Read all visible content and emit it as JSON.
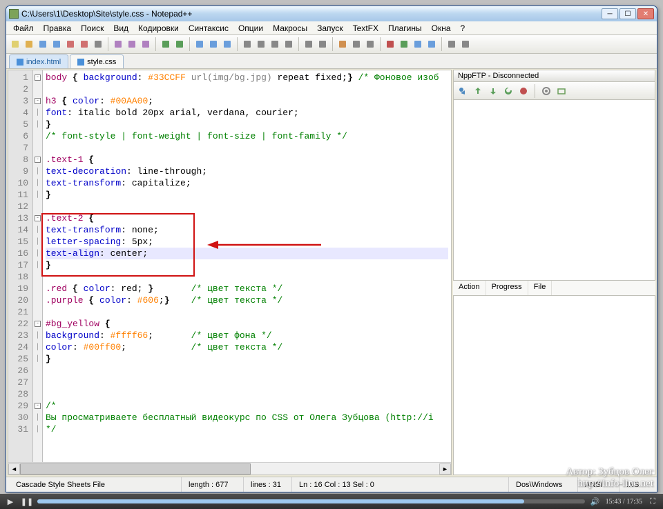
{
  "window": {
    "title": "C:\\Users\\1\\Desktop\\Site\\style.css - Notepad++"
  },
  "menu": {
    "items": [
      "Файл",
      "Правка",
      "Поиск",
      "Вид",
      "Кодировки",
      "Синтаксис",
      "Опции",
      "Макросы",
      "Запуск",
      "TextFX",
      "Плагины",
      "Окна",
      "?"
    ]
  },
  "tabs": [
    {
      "label": "index.html",
      "active": false
    },
    {
      "label": "style.css",
      "active": true
    }
  ],
  "code": {
    "lines_total": 31,
    "highlight_line": 16,
    "lines": [
      {
        "n": 1,
        "fold": "-",
        "html": "<span class='sel'>body</span> <span class='brace'>{</span> <span class='kw'>background</span>: <span class='num'>#33CCFF</span> <span class='str'>url(img/bg.jpg)</span> repeat fixed;<span class='brace'>}</span> <span class='comment'>/* Фоновое изоб</span>"
      },
      {
        "n": 2,
        "fold": "",
        "html": ""
      },
      {
        "n": 3,
        "fold": "-",
        "html": "<span class='sel'>h3</span> <span class='brace'>{</span> <span class='kw'>color</span>: <span class='num'>#00AA00</span>;"
      },
      {
        "n": 4,
        "fold": "|",
        "html": "<span class='kw'>font</span>: italic bold 20px arial, verdana, courier;"
      },
      {
        "n": 5,
        "fold": "|",
        "html": "<span class='brace'>}</span>"
      },
      {
        "n": 6,
        "fold": "",
        "html": "<span class='comment'>/* font-style | font-weight | font-size | font-family */</span>"
      },
      {
        "n": 7,
        "fold": "",
        "html": ""
      },
      {
        "n": 8,
        "fold": "-",
        "html": "<span class='sel'>.text-1</span> <span class='brace'>{</span>"
      },
      {
        "n": 9,
        "fold": "|",
        "html": "<span class='kw'>text-decoration</span>: line-through;"
      },
      {
        "n": 10,
        "fold": "|",
        "html": "<span class='kw'>text-transform</span>: capitalize;"
      },
      {
        "n": 11,
        "fold": "|",
        "html": "<span class='brace'>}</span>"
      },
      {
        "n": 12,
        "fold": "",
        "html": ""
      },
      {
        "n": 13,
        "fold": "-",
        "html": "<span class='sel'>.text-2</span> <span class='brace'>{</span>"
      },
      {
        "n": 14,
        "fold": "|",
        "html": "<span class='kw'>text-transform</span>: none;"
      },
      {
        "n": 15,
        "fold": "|",
        "html": "<span class='kw'>letter-spacing</span>: 5px;"
      },
      {
        "n": 16,
        "fold": "|",
        "html": "<span class='kw'>text-align</span>: center;"
      },
      {
        "n": 17,
        "fold": "|",
        "html": "<span class='brace'>}</span>"
      },
      {
        "n": 18,
        "fold": "",
        "html": ""
      },
      {
        "n": 19,
        "fold": "",
        "html": "<span class='sel'>.red</span> <span class='brace'>{</span> <span class='kw'>color</span>: red; <span class='brace'>}</span>       <span class='comment'>/* цвет текста */</span>"
      },
      {
        "n": 20,
        "fold": "",
        "html": "<span class='sel'>.purple</span> <span class='brace'>{</span> <span class='kw'>color</span>: <span class='num'>#606</span>;<span class='brace'>}</span>    <span class='comment'>/* цвет текста */</span>"
      },
      {
        "n": 21,
        "fold": "",
        "html": ""
      },
      {
        "n": 22,
        "fold": "-",
        "html": "<span class='sel'>#bg_yellow</span> <span class='brace'>{</span>"
      },
      {
        "n": 23,
        "fold": "|",
        "html": "<span class='kw'>background</span>: <span class='num'>#ffff66</span>;       <span class='comment'>/* цвет фона */</span>"
      },
      {
        "n": 24,
        "fold": "|",
        "html": "<span class='kw'>color</span>: <span class='num'>#00ff00</span>;            <span class='comment'>/* цвет текста */</span>"
      },
      {
        "n": 25,
        "fold": "|",
        "html": "<span class='brace'>}</span>"
      },
      {
        "n": 26,
        "fold": "",
        "html": ""
      },
      {
        "n": 27,
        "fold": "",
        "html": ""
      },
      {
        "n": 28,
        "fold": "",
        "html": ""
      },
      {
        "n": 29,
        "fold": "-",
        "html": "<span class='comment'>/*</span>"
      },
      {
        "n": 30,
        "fold": "|",
        "html": "<span class='comment'>Вы просматриваете бесплатный видеокурс по CSS от Олега Зубцова (http://i</span>"
      },
      {
        "n": 31,
        "fold": "|",
        "html": "<span class='comment'>*/</span>"
      }
    ]
  },
  "side": {
    "title": "NppFTP - Disconnected",
    "tabs": [
      "Action",
      "Progress",
      "File"
    ]
  },
  "status": {
    "filetype": "Cascade Style Sheets File",
    "length_label": "length : 677",
    "lines_label": "lines : 31",
    "pos": "Ln : 16   Col : 13   Sel : 0",
    "eol": "Dos\\Windows",
    "enc": "ANSI",
    "ins": "INS"
  },
  "watermark": {
    "l1": "Автор: Зубцов Олег",
    "l2": "http://info-line.net"
  },
  "player": {
    "time": "15:43 / 17:35"
  }
}
